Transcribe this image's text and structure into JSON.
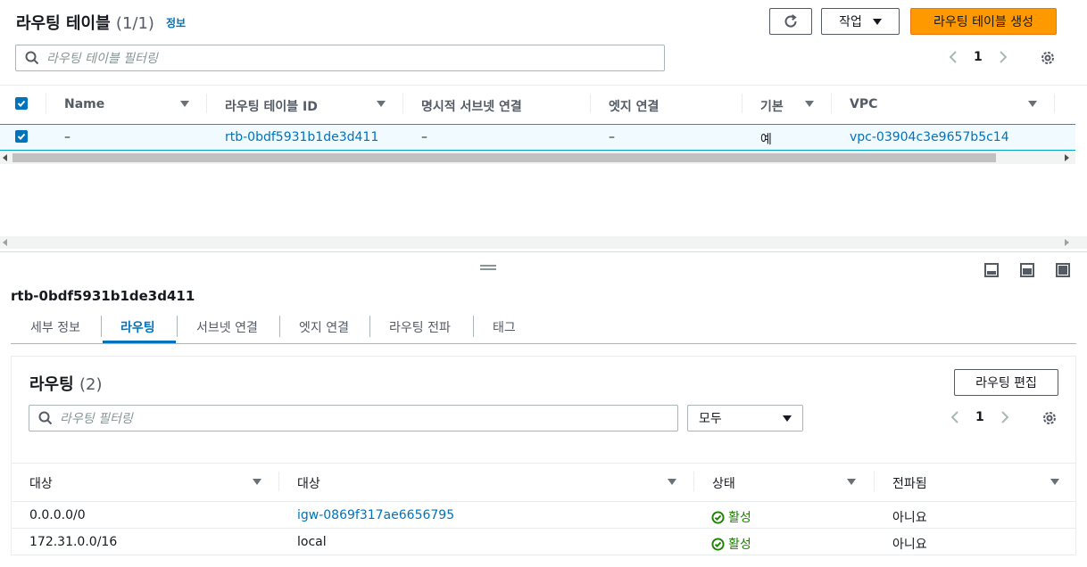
{
  "top": {
    "title": "라우팅 테이블",
    "count": "(1/1)",
    "info": "정보",
    "actions_label": "작업",
    "create_label": "라우팅 테이블 생성",
    "filter_placeholder": "라우팅 테이블 필터링",
    "page": "1"
  },
  "table": {
    "headers": [
      "Name",
      "라우팅 테이블 ID",
      "명시적 서브넷 연결",
      "엣지 연결",
      "기본",
      "VPC"
    ],
    "row": {
      "name": "–",
      "id": "rtb-0bdf5931b1de3d411",
      "subnet": "–",
      "edge": "–",
      "main": "예",
      "vpc": "vpc-03904c3e9657b5c14"
    }
  },
  "detail": {
    "title": "rtb-0bdf5931b1de3d411",
    "tabs": [
      "세부 정보",
      "라우팅",
      "서브넷 연결",
      "엣지 연결",
      "라우팅 전파",
      "태그"
    ],
    "active_tab": "라우팅"
  },
  "routes": {
    "title": "라우팅",
    "count": "(2)",
    "edit_label": "라우팅 편집",
    "filter_placeholder": "라우팅 필터링",
    "select_value": "모두",
    "page": "1",
    "headers": [
      "대상",
      "대상",
      "상태",
      "전파됨"
    ],
    "rows": [
      {
        "destination": "0.0.0.0/0",
        "target": "igw-0869f317ae6656795",
        "status": "활성",
        "propagated": "아니요"
      },
      {
        "destination": "172.31.0.0/16",
        "target": "local",
        "status": "활성",
        "propagated": "아니요"
      }
    ]
  },
  "colors": {
    "primary": "#ff9900",
    "link": "#0073bb",
    "success": "#1d8102"
  }
}
